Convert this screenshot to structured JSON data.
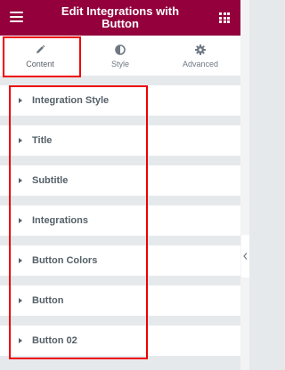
{
  "header": {
    "title": "Edit Integrations with Button",
    "menu_icon": "hamburger-icon",
    "apps_icon": "grid-icon"
  },
  "tabs": [
    {
      "label": "Content",
      "icon": "pencil-icon",
      "active": true
    },
    {
      "label": "Style",
      "icon": "half-circle-icon",
      "active": false
    },
    {
      "label": "Advanced",
      "icon": "gear-icon",
      "active": false
    }
  ],
  "sections": [
    {
      "label": "Integration Style"
    },
    {
      "label": "Title"
    },
    {
      "label": "Subtitle"
    },
    {
      "label": "Integrations"
    },
    {
      "label": "Button Colors"
    },
    {
      "label": "Button"
    },
    {
      "label": "Button 02"
    }
  ],
  "colors": {
    "header_bg": "#93003c",
    "highlight": "#ee0000",
    "panel_bg": "#e6e9ec",
    "text": "#556068"
  }
}
